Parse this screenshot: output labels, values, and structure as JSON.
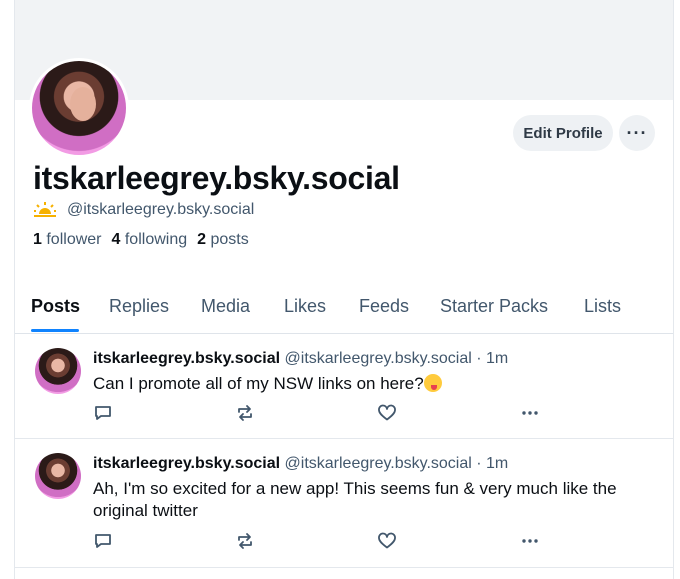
{
  "profile": {
    "display_name": "itskarleegrey.bsky.social",
    "handle": "@itskarleegrey.bsky.social",
    "edit_label": "Edit Profile",
    "more_glyph": "···"
  },
  "stats": {
    "followers_count": "1",
    "followers_label": "follower",
    "following_count": "4",
    "following_label": "following",
    "posts_count": "2",
    "posts_label": "posts"
  },
  "tabs": [
    {
      "label": "Posts",
      "active": true
    },
    {
      "label": "Replies"
    },
    {
      "label": "Media"
    },
    {
      "label": "Likes"
    },
    {
      "label": "Feeds"
    },
    {
      "label": "Starter Packs"
    },
    {
      "label": "Lists"
    }
  ],
  "posts": [
    {
      "author": "itskarleegrey.bsky.social",
      "handle": "@itskarleegrey.bsky.social",
      "separator": "·",
      "time": "1m",
      "text": "Can I promote all of my NSW links on here?"
    },
    {
      "author": "itskarleegrey.bsky.social",
      "handle": "@itskarleegrey.bsky.social",
      "separator": "·",
      "time": "1m",
      "text": "Ah, I'm so excited for a new app! This seems fun & very much like the original twitter"
    }
  ],
  "icons": {
    "reply": "reply-icon",
    "repost": "repost-icon",
    "like": "heart-icon",
    "more": "more-dots-icon"
  },
  "colors": {
    "accent": "#1083fe",
    "muted_text": "#42576c",
    "button_bg": "#eef1f4"
  }
}
